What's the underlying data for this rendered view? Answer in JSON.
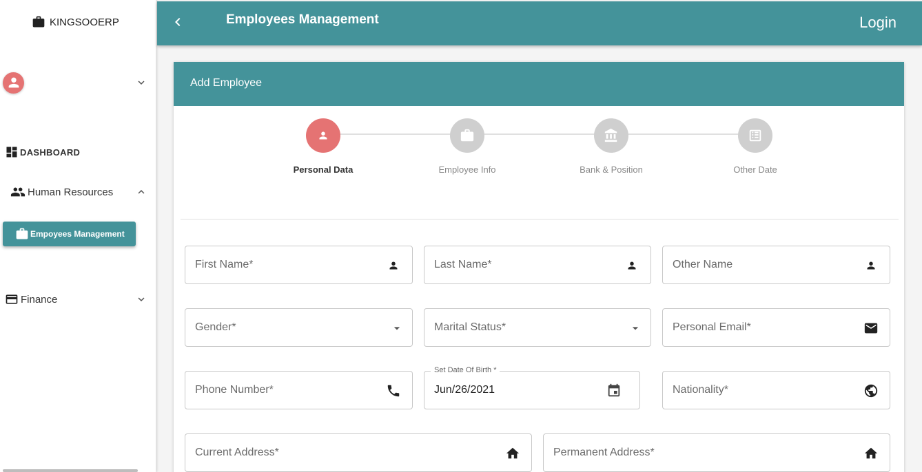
{
  "sidebar": {
    "brand": "KINGSOOERP",
    "dashboard": "DASHBOARD",
    "human_resources": "Human Resources",
    "employees_management": "Empoyees Management",
    "finance": "Finance"
  },
  "header": {
    "title": "Employees Management",
    "login": "Login"
  },
  "card": {
    "title": "Add Employee"
  },
  "steps": [
    {
      "label": "Personal Data",
      "active": true,
      "icon": "person-icon"
    },
    {
      "label": "Employee Info",
      "active": false,
      "icon": "briefcase-icon"
    },
    {
      "label": "Bank & Position",
      "active": false,
      "icon": "bank-icon"
    },
    {
      "label": "Other Date",
      "active": false,
      "icon": "list-icon"
    }
  ],
  "form": {
    "first_name": "First Name*",
    "last_name": "Last Name*",
    "other_name": "Other Name",
    "gender": "Gender*",
    "marital_status": "Marital Status*",
    "personal_email": "Personal Email*",
    "phone_number": "Phone Number*",
    "dob_label": "Set Date Of Birth *",
    "dob_value": "Jun/26/2021",
    "nationality": "Nationality*",
    "current_address": "Current Address*",
    "permanent_address": "Permanent Address*"
  },
  "colors": {
    "primary": "#44939a",
    "accent": "#e57373",
    "inactive_step": "#cfcfcf"
  }
}
